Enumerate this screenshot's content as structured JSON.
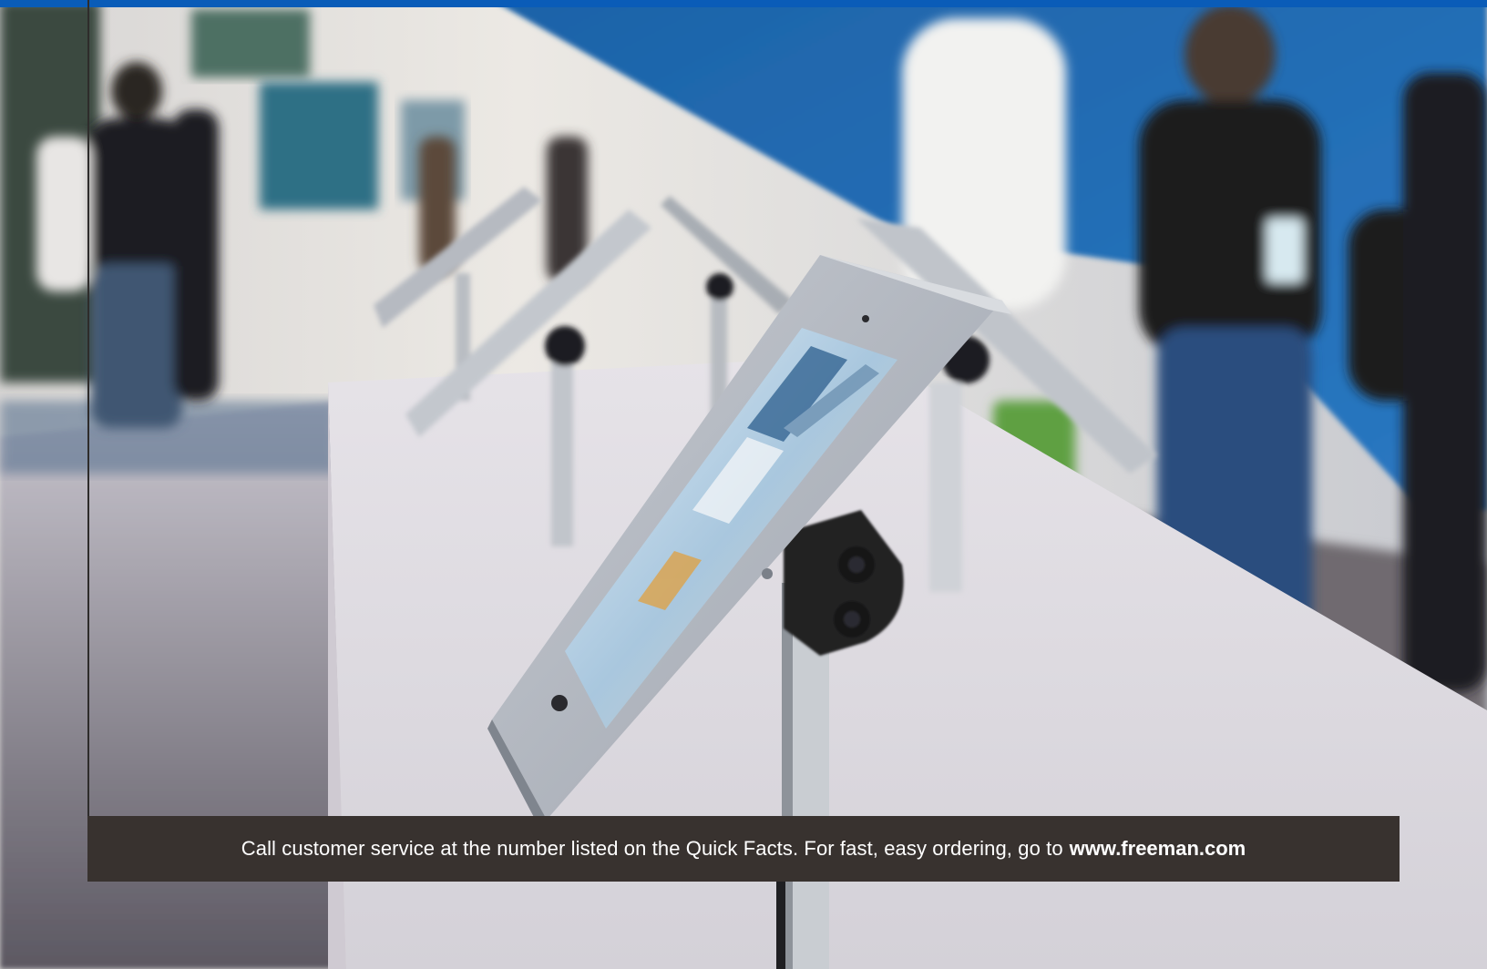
{
  "colors": {
    "accent_blue": "#0a5cb8",
    "banner_background": "#38322f",
    "banner_text": "#ffffff",
    "rule": "#2e2c2b"
  },
  "photo": {
    "subject": "trade-show kiosk-tablets-on-stands-photo"
  },
  "footer": {
    "text": "Call customer service at the number listed on the Quick Facts. For fast, easy ordering, go to",
    "link_text": "www.freeman.com"
  }
}
